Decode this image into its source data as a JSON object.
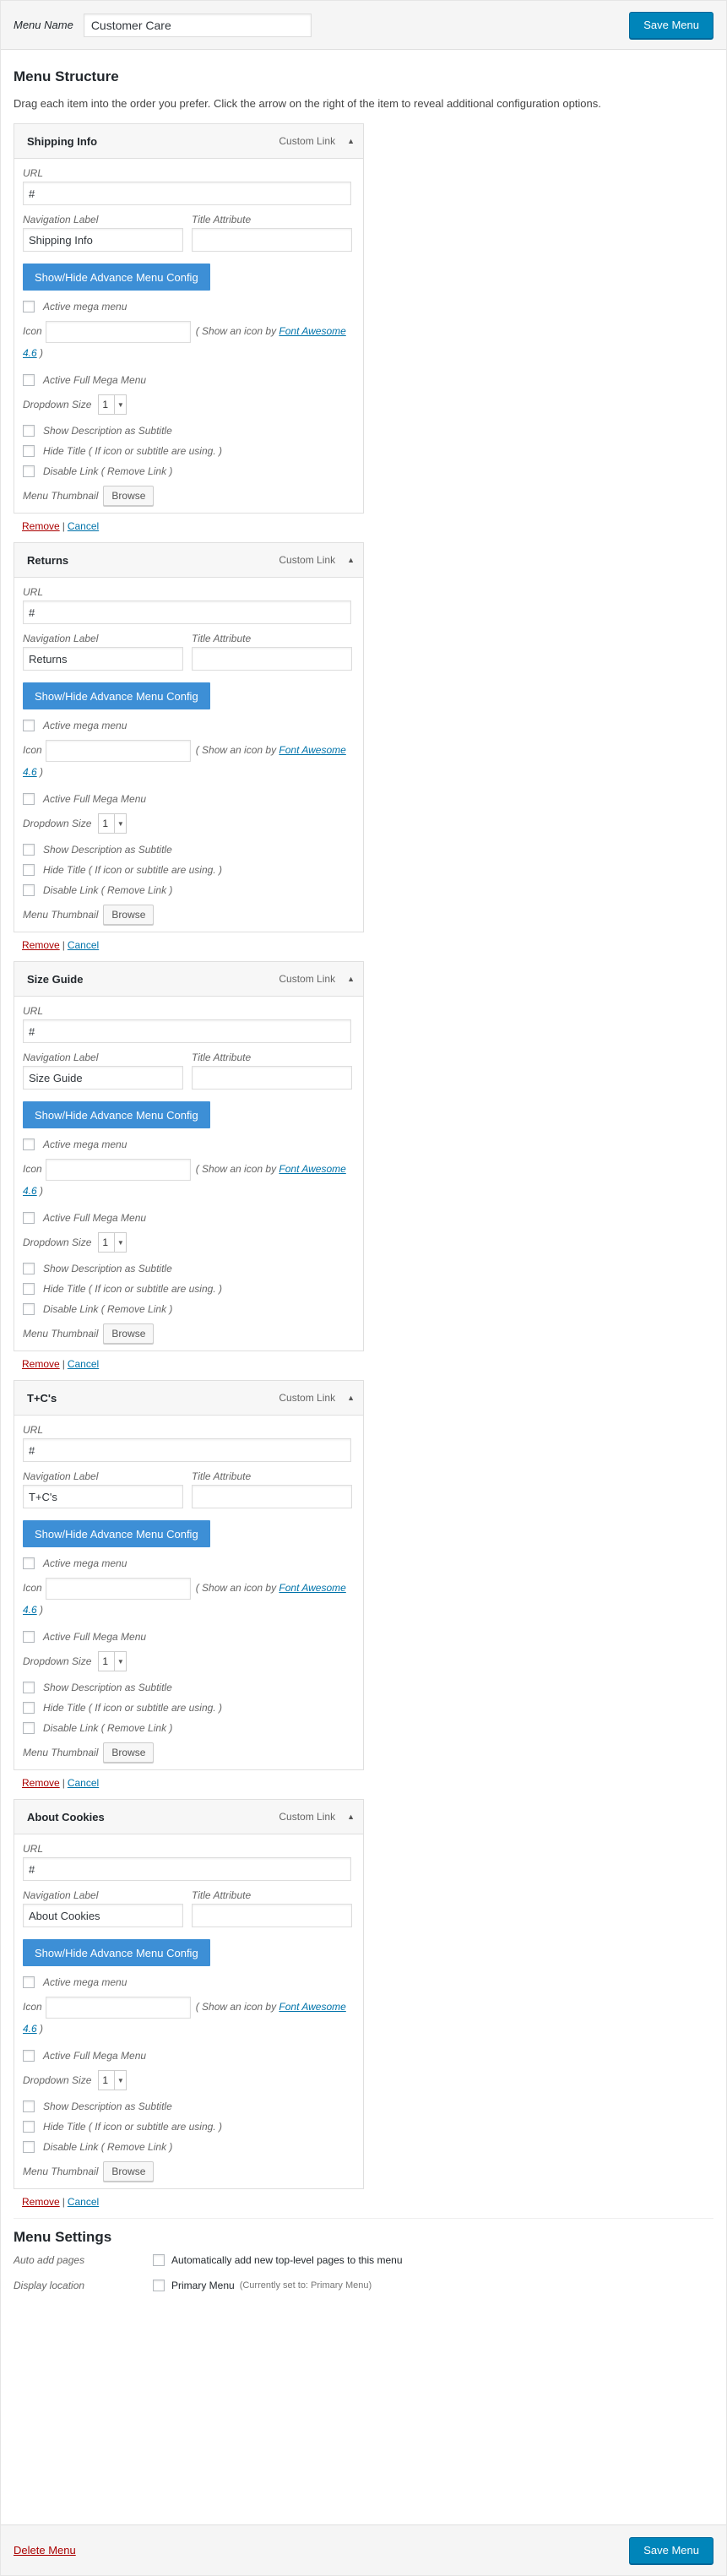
{
  "header": {
    "menu_name_label": "Menu Name",
    "menu_name_value": "Customer Care",
    "save_label": "Save Menu"
  },
  "structure": {
    "title": "Menu Structure",
    "instructions": "Drag each item into the order you prefer. Click the arrow on the right of the item to reveal additional configuration options."
  },
  "labels": {
    "url": "URL",
    "navigation_label": "Navigation Label",
    "title_attribute": "Title Attribute",
    "config_button": "Show/Hide Advance Menu Config",
    "active_mega": "Active mega menu",
    "icon": "Icon",
    "icon_hint": "( Show an icon by",
    "icon_link": "Font Awesome 4.6",
    "icon_hint_end": ")",
    "active_full": "Active Full Mega Menu",
    "dropdown_size": "Dropdown Size",
    "dropdown_value": "1",
    "show_desc": "Show Description as Subtitle",
    "hide_title": "Hide Title ( If icon or subtitle are using. )",
    "disable_link": "Disable Link ( Remove Link )",
    "thumbnail": "Menu Thumbnail",
    "browse": "Browse",
    "remove": "Remove",
    "separator": "|",
    "cancel": "Cancel"
  },
  "items": [
    {
      "title": "Shipping Info",
      "type": "Custom Link",
      "url": "#",
      "nav_label": "Shipping Info"
    },
    {
      "title": "Returns",
      "type": "Custom Link",
      "url": "#",
      "nav_label": "Returns"
    },
    {
      "title": "Size Guide",
      "type": "Custom Link",
      "url": "#",
      "nav_label": "Size Guide"
    },
    {
      "title": "T+C's",
      "type": "Custom Link",
      "url": "#",
      "nav_label": "T+C's"
    },
    {
      "title": "About Cookies",
      "type": "Custom Link",
      "url": "#",
      "nav_label": "About Cookies"
    }
  ],
  "settings": {
    "title": "Menu Settings",
    "auto_add_label": "Auto add pages",
    "auto_add_text": "Automatically add new top-level pages to this menu",
    "display_label": "Display location",
    "primary_menu": "Primary Menu",
    "primary_note": "(Currently set to: Primary Menu)"
  },
  "footer": {
    "delete_label": "Delete Menu",
    "save_label": "Save Menu"
  }
}
